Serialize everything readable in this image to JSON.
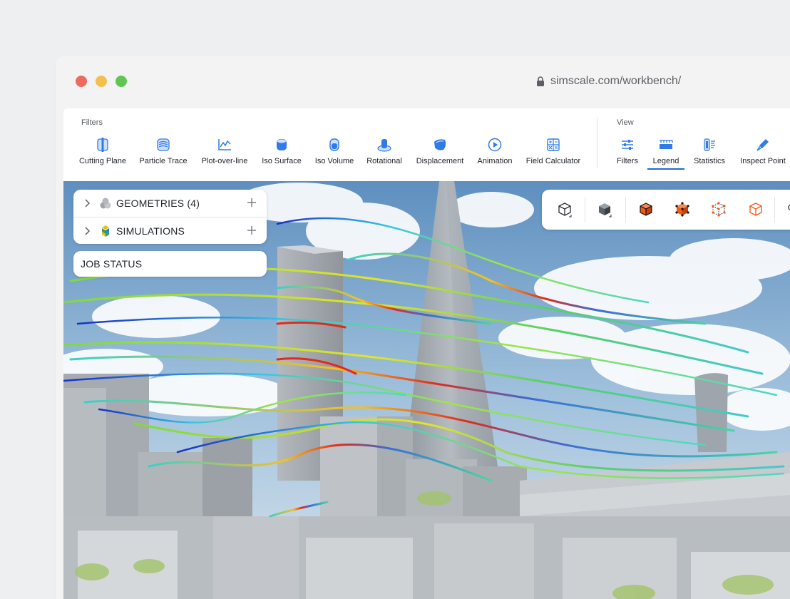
{
  "browser": {
    "url": "simscale.com/workbench/"
  },
  "toolbar": {
    "filters_label": "Filters",
    "view_label": "View",
    "filters": [
      {
        "label": "Cutting Plane",
        "icon": "cutting-plane-icon"
      },
      {
        "label": "Particle Trace",
        "icon": "particle-trace-icon"
      },
      {
        "label": "Plot-over-line",
        "icon": "plot-over-line-icon"
      },
      {
        "label": "Iso Surface",
        "icon": "iso-surface-icon"
      },
      {
        "label": "Iso Volume",
        "icon": "iso-volume-icon"
      },
      {
        "label": "Rotational",
        "icon": "rotational-icon"
      },
      {
        "label": "Displacement",
        "icon": "displacement-icon"
      },
      {
        "label": "Animation",
        "icon": "animation-icon"
      },
      {
        "label": "Field Calculator",
        "icon": "field-calculator-icon"
      }
    ],
    "view": [
      {
        "label": "Filters",
        "icon": "filters-sliders-icon"
      },
      {
        "label": "Legend",
        "icon": "legend-icon",
        "active": true
      },
      {
        "label": "Statistics",
        "icon": "statistics-icon"
      },
      {
        "label": "Inspect Point",
        "icon": "inspect-point-icon"
      }
    ]
  },
  "tree": {
    "geometries": "GEOMETRIES (4)",
    "simulations": "SIMULATIONS"
  },
  "job_status": "JOB STATUS",
  "colors": {
    "accent": "#1e6ad6",
    "icon_blue": "#2f7be8",
    "cube_orange": "#f05a1a"
  }
}
